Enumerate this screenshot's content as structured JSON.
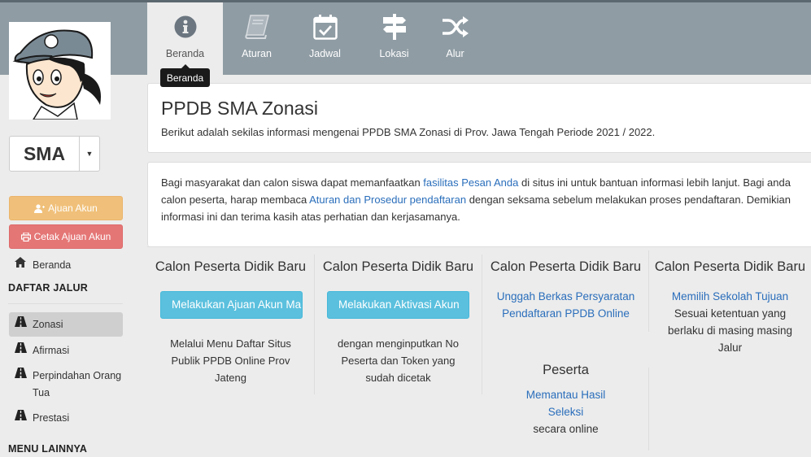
{
  "tabs": [
    {
      "label": "Beranda",
      "icon": "info-circle-icon",
      "active": true
    },
    {
      "label": "Aturan",
      "icon": "book-icon",
      "active": false
    },
    {
      "label": "Jadwal",
      "icon": "calendar-check-icon",
      "active": false
    },
    {
      "label": "Lokasi",
      "icon": "signpost-icon",
      "active": false
    },
    {
      "label": "Alur",
      "icon": "random-icon",
      "active": false
    }
  ],
  "tooltip": "Beranda",
  "sidebar": {
    "level_label": "SMA",
    "btn_ajuan": "Ajuan Akun",
    "btn_cetak": "Cetak Ajuan Akun",
    "home_link": "Beranda",
    "section_jalur": "DAFTAR JALUR",
    "jalur": [
      "Zonasi",
      "Afirmasi",
      "Perpindahan Orang Tua",
      "Prestasi"
    ],
    "section_lain": "MENU LAINNYA"
  },
  "header": {
    "title": "PPDB SMA Zonasi",
    "subtitle": "Berikut adalah sekilas informasi mengenai PPDB SMA Zonasi di Prov. Jawa Tengah Periode 2021 / 2022."
  },
  "intro": {
    "part1": "Bagi masyarakat dan calon siswa dapat memanfaatkan ",
    "link1": "fasilitas Pesan Anda",
    "part2": " di situs ini untuk bantuan informasi lebih lanjut. Bagi anda calon peserta, harap membaca ",
    "link2": "Aturan dan Prosedur pendaftaran",
    "part3": " dengan seksama sebelum melakukan proses pendaftaran. Demikian informasi ini dan terima kasih atas perhatian dan kerjasamanya."
  },
  "steps": [
    {
      "title": "Calon Peserta Didik Baru",
      "button": "Melakukan Ajuan Akun Ma",
      "desc": "Melalui Menu Daftar Situs Publik PPDB Online Prov Jateng"
    },
    {
      "title": "Calon Peserta Didik Baru",
      "button": "Melakukan Aktivasi Akun",
      "desc": "dengan menginputkan No Peserta dan Token yang sudah dicetak"
    },
    {
      "title": "Calon Peserta Didik Baru",
      "link": "Unggah Berkas Persyaratan Pendaftaran PPDB Online",
      "desc": ""
    },
    {
      "title": "Calon Peserta Didik Baru",
      "link": "Memilih Sekolah Tujuan",
      "desc": "Sesuai ketentuan yang berlaku di masing masing Jalur"
    }
  ],
  "peserta": {
    "title": "Peserta",
    "link": "Memantau Hasil Seleksi",
    "desc": "secara online"
  },
  "colors": {
    "topbar": "#8f9ca4",
    "info": "#5bc0de",
    "warning": "#f0c07a",
    "danger": "#e57676",
    "link": "#2a6ebb"
  }
}
